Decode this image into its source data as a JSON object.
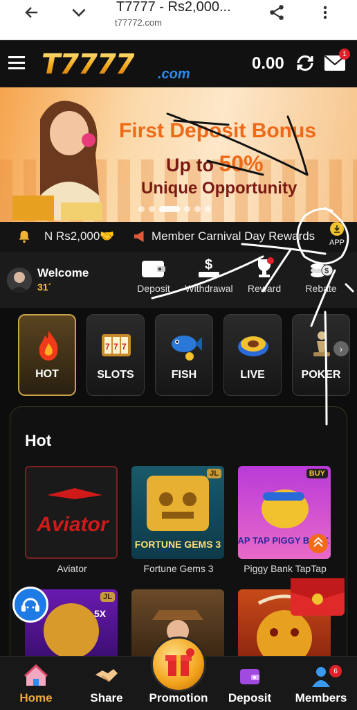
{
  "browser": {
    "title": "T7777 - Rs2,000...",
    "url": "t77772.com"
  },
  "header": {
    "logo_text": "T7777",
    "logo_suffix": ".com",
    "balance": "0.00",
    "mail_badge": "1"
  },
  "banner": {
    "line1": "First Deposit Bonus",
    "line2_prefix": "Up to",
    "line2_highlight": "50%",
    "line3": "Unique Opportunity",
    "active_slide": 3
  },
  "marquee": {
    "text1": "N Rs2,000🤝",
    "text2": "Member Carnival Day Rewards"
  },
  "app_button": {
    "label": "APP"
  },
  "user": {
    "welcome": "Welcome",
    "id_partial": "31´"
  },
  "quick_actions": [
    {
      "label": "Deposit",
      "icon": "wallet-icon"
    },
    {
      "label": "Withdrawal",
      "icon": "dollar-withdraw-icon"
    },
    {
      "label": "Reward",
      "icon": "trophy-icon"
    },
    {
      "label": "Rebate",
      "icon": "coins-icon"
    }
  ],
  "categories": [
    {
      "label": "HOT",
      "icon": "flame-icon",
      "active": true
    },
    {
      "label": "SLOTS",
      "icon": "slot-777-icon",
      "active": false
    },
    {
      "label": "FISH",
      "icon": "fish-icon",
      "active": false
    },
    {
      "label": "LIVE",
      "icon": "roulette-icon",
      "active": false
    },
    {
      "label": "POKER",
      "icon": "chess-pawn-icon",
      "active": false
    }
  ],
  "hot_section": {
    "title": "Hot",
    "games": [
      {
        "name": "Aviator",
        "art_text": "Aviator",
        "badge": ""
      },
      {
        "name": "Fortune Gems 3",
        "art_text": "FORTUNE GEMS 3",
        "badge": "JL"
      },
      {
        "name": "Piggy Bank TapTap",
        "art_text": "TAP TAP PIGGY BANK",
        "badge": "BUY"
      },
      {
        "name": "",
        "art_text": "5X",
        "badge": "JL"
      },
      {
        "name": "",
        "art_text": "",
        "badge": ""
      },
      {
        "name": "",
        "art_text": "",
        "badge": ""
      }
    ]
  },
  "bottom_nav": [
    {
      "label": "Home",
      "icon": "home-icon",
      "active": true
    },
    {
      "label": "Share",
      "icon": "handshake-icon",
      "active": false
    },
    {
      "label": "Promotion",
      "icon": "gift-icon",
      "active": false
    },
    {
      "label": "Deposit",
      "icon": "deposit-card-icon",
      "active": false
    },
    {
      "label": "Members",
      "icon": "members-icon",
      "active": false,
      "badge": "6"
    }
  ],
  "colors": {
    "accent_gold": "#f2a935",
    "banner_orange": "#ee6a18",
    "banner_maroon": "#7a1a14",
    "badge_red": "#e0202a"
  }
}
